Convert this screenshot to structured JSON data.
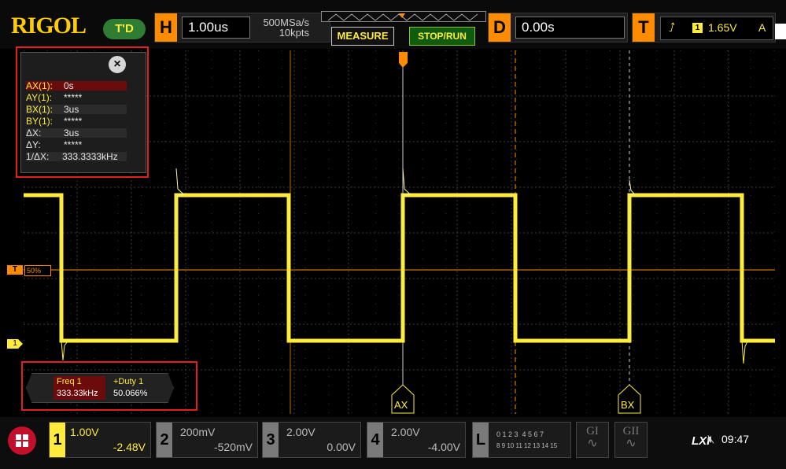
{
  "brand": "RIGOL",
  "run_state": "T'D",
  "horizontal": {
    "label": "H",
    "timebase": "1.00us",
    "sample_rate": "500MSa/s",
    "memory_depth": "10kpts"
  },
  "buttons": {
    "measure": "MEASURE",
    "stop_run": "STOP/RUN"
  },
  "delay": {
    "label": "D",
    "value": "0.00s"
  },
  "trigger": {
    "label": "T",
    "source": "1",
    "level": "1.65V",
    "mode": "A"
  },
  "trigger_level_marker": {
    "label": "T",
    "percent": "50%"
  },
  "ch1_marker": "1",
  "cursor_table": {
    "close_icon": "close-icon",
    "rows": [
      {
        "key": "AX(1):",
        "value": "0s"
      },
      {
        "key": "AY(1):",
        "value": "*****"
      },
      {
        "key": "BX(1):",
        "value": "3us"
      },
      {
        "key": "BY(1):",
        "value": "*****"
      },
      {
        "key": "ΔX:",
        "value": "3us"
      },
      {
        "key": "ΔY:",
        "value": "*****"
      },
      {
        "key": "1/ΔX:",
        "value": "333.3333kHz"
      }
    ]
  },
  "measurements": [
    {
      "label": "Freq 1",
      "value": "333.33kHz"
    },
    {
      "label": "+Duty 1",
      "value": "50.066%"
    }
  ],
  "cursor_tags": {
    "a": "AX",
    "b": "BX"
  },
  "channels": [
    {
      "num": "1",
      "scale": "1.00V",
      "offset": "-2.48V",
      "color": "#ffeb3b"
    },
    {
      "num": "2",
      "scale": "200mV",
      "offset": "-520mV",
      "color": "#7a7a7a"
    },
    {
      "num": "3",
      "scale": "2.00V",
      "offset": "0.00V",
      "color": "#7a7a7a"
    },
    {
      "num": "4",
      "scale": "2.00V",
      "offset": "-4.00V",
      "color": "#7a7a7a"
    }
  ],
  "logic": {
    "label": "L",
    "row1": "0 1 2 3  4 5 6 7",
    "row2": "8 9 10 11 12 13 14 15"
  },
  "generators": [
    "GI",
    "GII"
  ],
  "status": {
    "lxi": "LXI",
    "speaker_icon": "speaker-muted-icon",
    "time": "09:47"
  },
  "colors": {
    "ch1": "#ffeb3b",
    "accent": "#ff8c00",
    "highlight_box": "#e51d1d"
  }
}
